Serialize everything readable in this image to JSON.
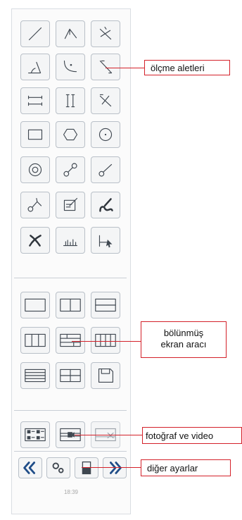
{
  "measurement_tools": {
    "callout": "ölçme aletleri",
    "icons": [
      "line-icon",
      "angle-bisector-icon",
      "crossing-lines-icon",
      "angle-measure-icon",
      "curve-measure-icon",
      "diagonal-line-icon",
      "parallel-horizontal-icon",
      "parallel-vertical-icon",
      "diagonal-lines-icon",
      "rectangle-icon",
      "hexagon-icon",
      "circle-icon",
      "concentric-circles-icon",
      "two-circle-link-icon",
      "circle-line-icon",
      "point-branch-icon",
      "edit-icon",
      "signature-icon",
      "cross-tool-icon",
      "histogram-icon",
      "cursor-axis-icon"
    ]
  },
  "split_screen_tool": {
    "callout_line1": "bölünmüş",
    "callout_line2": "ekran aracı",
    "layouts": [
      "single",
      "two-columns",
      "two-rows",
      "three-columns",
      "grid-rows",
      "four-columns",
      "four-rows",
      "four-panes",
      "save"
    ]
  },
  "photo_video": {
    "callout": "fotoğraf ve video"
  },
  "other_settings": {
    "callout": "diğer ayarlar"
  },
  "status": {
    "time": "18:39"
  }
}
